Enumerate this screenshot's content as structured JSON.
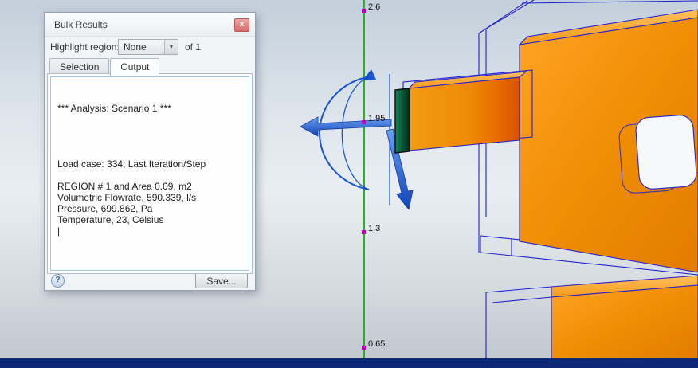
{
  "dialog": {
    "title": "Bulk Results",
    "close_label": "x",
    "highlight_region_label": "Highlight region:",
    "dropdown_value": "None",
    "of_count": "of 1",
    "tabs": [
      {
        "label": "Selection"
      },
      {
        "label": "Output"
      }
    ],
    "output_lines": [
      "",
      "",
      "*** Analysis: Scenario 1 ***",
      "",
      "",
      "",
      "",
      "Load case: 334; Last Iteration/Step",
      "",
      "REGION # 1 and Area 0.09, m2",
      "Volumetric Flowrate, 590.339, l/s",
      "Pressure, 699.862, Pa",
      "Temperature, 23, Celsius",
      "|"
    ],
    "help_icon": "?",
    "save_button": "Save..."
  },
  "viewport": {
    "axis_ticks": [
      {
        "label": "2.6"
      },
      {
        "label": "1.95"
      },
      {
        "label": "1.3"
      },
      {
        "label": "0.65"
      }
    ],
    "colors": {
      "axis_green": "#2cae2c",
      "tick_magenta": "#bb00bb",
      "arrow_blue": "#1a54cc",
      "wireframe_blue": "#2323cd",
      "model_orange": "#ef8e06",
      "inlet_teal": "#0a5c3a",
      "bottom_strip_navy": "#0e2878"
    }
  }
}
